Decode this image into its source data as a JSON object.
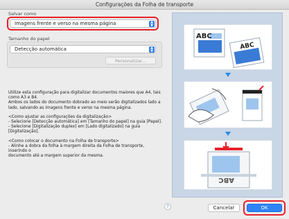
{
  "window": {
    "title": "Configurações da Folha de transporte"
  },
  "save_as": {
    "label": "Salvar como",
    "selected": "Imagens frente e verso na mesma página"
  },
  "paper_size": {
    "label": "Tamanho do papel",
    "selected": "Detecção automática",
    "custom_button": "Personalizar..."
  },
  "description": {
    "p1_lines": [
      "Utilize esta configuração para digitalizar documentos maiores que A4, tais",
      "como A3 e B4.",
      "Ambos os lados do documento dobrado ao meio serão digitalizados lado a",
      "lado, salvando as imagens frente e verso na mesma página."
    ],
    "p2_lines": [
      "<Como ajustar as configurações da digitalização>",
      "- Selecione [Detecção automática] em [Tamanho do papel] na guia [Papel].",
      "- Selecione [Digitalização duplex] em [Lado digitalizado] na guia",
      "[Digitalização]."
    ],
    "p3_lines": [
      "<Como colocar o documento na Folha de transporte>",
      "- Alinhe a dobra da folha à margem direita da Folha de transporte, inserindo o",
      "documento até a margem superior da mesma."
    ]
  },
  "illustration": {
    "doc_text_1": "ABC",
    "doc_text_2": "ABC",
    "doc_text_3": "ABC",
    "accent_color": "#2b8be0",
    "marker_color": "#e8212b"
  },
  "footer": {
    "help": "?",
    "cancel": "Cancelar",
    "ok": "OK"
  }
}
